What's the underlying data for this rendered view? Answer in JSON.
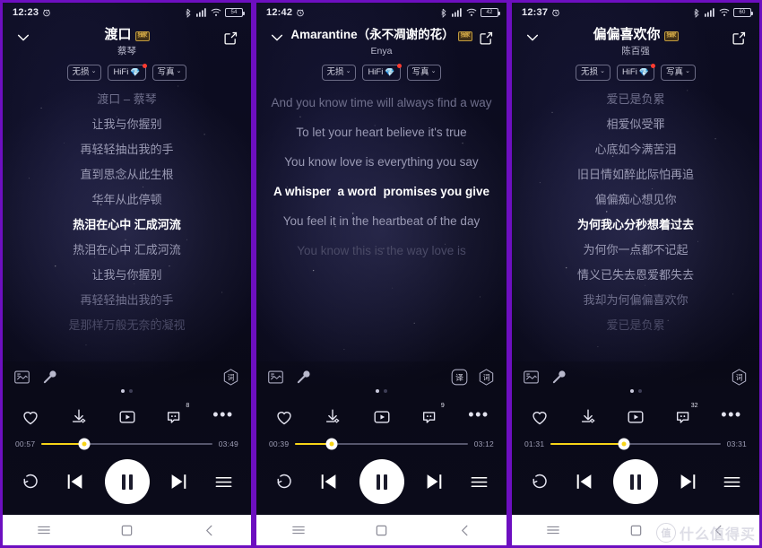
{
  "panels": [
    {
      "status": {
        "time": "12:23",
        "alarm_icon": "alarm-icon",
        "bluetooth_icon": "bluetooth-icon",
        "signal_icon": "signal-icon",
        "wifi_icon": "wifi-icon",
        "battery_level": "54"
      },
      "header": {
        "collapse_icon": "chevron-down-icon",
        "share_icon": "share-icon",
        "title": "渡口",
        "title_badge": "独家",
        "artist": "蔡琴"
      },
      "chips": [
        {
          "label": "无损",
          "caret": "⌄",
          "gem": false,
          "dot": false
        },
        {
          "label": "HiFi",
          "caret": "",
          "gem": true,
          "dot": true
        },
        {
          "label": "写真",
          "caret": "⌄",
          "gem": false,
          "dot": false
        }
      ],
      "lyrics": [
        {
          "text": "渡口 – 蔡琴",
          "state": "dim2"
        },
        {
          "text": "让我与你握别",
          "state": "dim1"
        },
        {
          "text": "再轻轻抽出我的手",
          "state": "dim1"
        },
        {
          "text": "直到思念从此生根",
          "state": "dim1"
        },
        {
          "text": "华年从此停顿",
          "state": "dim1"
        },
        {
          "text": "热泪在心中 汇成河流",
          "state": "active"
        },
        {
          "text": "热泪在心中 汇成河流",
          "state": "dim1"
        },
        {
          "text": "让我与你握别",
          "state": "dim1"
        },
        {
          "text": "再轻轻抽出我的手",
          "state": "dim2"
        },
        {
          "text": "是那样万般无奈的凝视",
          "state": "dim3"
        }
      ],
      "utility": {
        "poster_icon": "poster-image-icon",
        "mic_icon": "microphone-icon",
        "translate_label": "",
        "has_translate": false,
        "lyric_label": "词"
      },
      "page_dots": {
        "count": 2,
        "active": 0
      },
      "actions": {
        "like_icon": "heart-icon",
        "download_icon": "download-icon",
        "video_icon": "video-icon",
        "comment_icon": "comment-icon",
        "comment_count": "8",
        "more_icon": "more-icon"
      },
      "progress": {
        "elapsed": "00:57",
        "total": "03:49",
        "percent": 25
      },
      "transport": {
        "repeat_icon": "repeat-icon",
        "prev_icon": "previous-icon",
        "play_icon": "pause-icon",
        "next_icon": "next-icon",
        "playlist_icon": "playlist-icon"
      },
      "navbar": {
        "menu_icon": "recents-icon",
        "home_icon": "home-icon",
        "back_icon": "back-icon"
      }
    },
    {
      "status": {
        "time": "12:42",
        "alarm_icon": "alarm-icon",
        "bluetooth_icon": "bluetooth-icon",
        "signal_icon": "signal-icon",
        "wifi_icon": "wifi-icon",
        "battery_level": "42"
      },
      "header": {
        "collapse_icon": "chevron-down-icon",
        "share_icon": "share-icon",
        "title": "Amarantine（永不凋谢的花）",
        "title_badge": "独家",
        "artist": "Enya"
      },
      "chips": [
        {
          "label": "无损",
          "caret": "⌄",
          "gem": false,
          "dot": false
        },
        {
          "label": "HiFi",
          "caret": "",
          "gem": true,
          "dot": true
        },
        {
          "label": "写真",
          "caret": "⌄",
          "gem": false,
          "dot": false
        }
      ],
      "lyrics": [
        {
          "text": "And you know time will always find a way",
          "state": "dim2"
        },
        {
          "text": "To let your heart believe it's true",
          "state": "dim1"
        },
        {
          "text": "You know love is everything you say",
          "state": "dim1"
        },
        {
          "text": "A whisper  a word  promises you give",
          "state": "active"
        },
        {
          "text": "You feel it in the heartbeat of the day",
          "state": "dim1"
        },
        {
          "text": "You know this is the way love is",
          "state": "dim3"
        }
      ],
      "utility": {
        "poster_icon": "poster-image-icon",
        "mic_icon": "microphone-icon",
        "translate_label": "译",
        "has_translate": true,
        "lyric_label": "词"
      },
      "page_dots": {
        "count": 2,
        "active": 0
      },
      "actions": {
        "like_icon": "heart-icon",
        "download_icon": "download-icon",
        "video_icon": "video-icon",
        "comment_icon": "comment-icon",
        "comment_count": "9",
        "more_icon": "more-icon"
      },
      "progress": {
        "elapsed": "00:39",
        "total": "03:12",
        "percent": 21
      },
      "transport": {
        "repeat_icon": "repeat-icon",
        "prev_icon": "previous-icon",
        "play_icon": "pause-icon",
        "next_icon": "next-icon",
        "playlist_icon": "playlist-icon"
      },
      "navbar": {
        "menu_icon": "recents-icon",
        "home_icon": "home-icon",
        "back_icon": "back-icon"
      }
    },
    {
      "status": {
        "time": "12:37",
        "alarm_icon": "alarm-icon",
        "bluetooth_icon": "bluetooth-icon",
        "signal_icon": "signal-icon",
        "wifi_icon": "wifi-icon",
        "battery_level": "60"
      },
      "header": {
        "collapse_icon": "chevron-down-icon",
        "share_icon": "share-icon",
        "title": "偏偏喜欢你",
        "title_badge": "独家",
        "artist": "陈百强"
      },
      "chips": [
        {
          "label": "无损",
          "caret": "⌄",
          "gem": false,
          "dot": false
        },
        {
          "label": "HiFi",
          "caret": "",
          "gem": true,
          "dot": true
        },
        {
          "label": "写真",
          "caret": "⌄",
          "gem": false,
          "dot": false
        }
      ],
      "lyrics": [
        {
          "text": "爱已是负累",
          "state": "dim2"
        },
        {
          "text": "相爱似受罪",
          "state": "dim1"
        },
        {
          "text": "心底如今满苦泪",
          "state": "dim1"
        },
        {
          "text": "旧日情如醉此际怕再追",
          "state": "dim1"
        },
        {
          "text": "偏偏痴心想见你",
          "state": "dim1"
        },
        {
          "text": "为何我心分秒想着过去",
          "state": "active"
        },
        {
          "text": "为何你一点都不记起",
          "state": "dim1"
        },
        {
          "text": "情义已失去恩爱都失去",
          "state": "dim1"
        },
        {
          "text": "我却为何偏偏喜欢你",
          "state": "dim2"
        },
        {
          "text": "爱已是负累",
          "state": "dim3"
        }
      ],
      "utility": {
        "poster_icon": "poster-image-icon",
        "mic_icon": "microphone-icon",
        "translate_label": "",
        "has_translate": false,
        "lyric_label": "词"
      },
      "page_dots": {
        "count": 2,
        "active": 0
      },
      "actions": {
        "like_icon": "heart-icon",
        "download_icon": "download-icon",
        "video_icon": "video-icon",
        "comment_icon": "comment-icon",
        "comment_count": "32",
        "more_icon": "more-icon"
      },
      "progress": {
        "elapsed": "01:31",
        "total": "03:31",
        "percent": 43
      },
      "transport": {
        "repeat_icon": "repeat-icon",
        "prev_icon": "previous-icon",
        "play_icon": "pause-icon",
        "next_icon": "next-icon",
        "playlist_icon": "playlist-icon"
      },
      "navbar": {
        "menu_icon": "recents-icon",
        "home_icon": "home-icon",
        "back_icon": "back-icon"
      }
    }
  ],
  "watermark": {
    "logo": "值",
    "text": "什么值得买"
  },
  "colors": {
    "accent_yellow": "#f7d417",
    "border_purple": "#6d0fc0",
    "bg_dark": "#0a0a1a",
    "active_lyric": "#ffffff"
  }
}
